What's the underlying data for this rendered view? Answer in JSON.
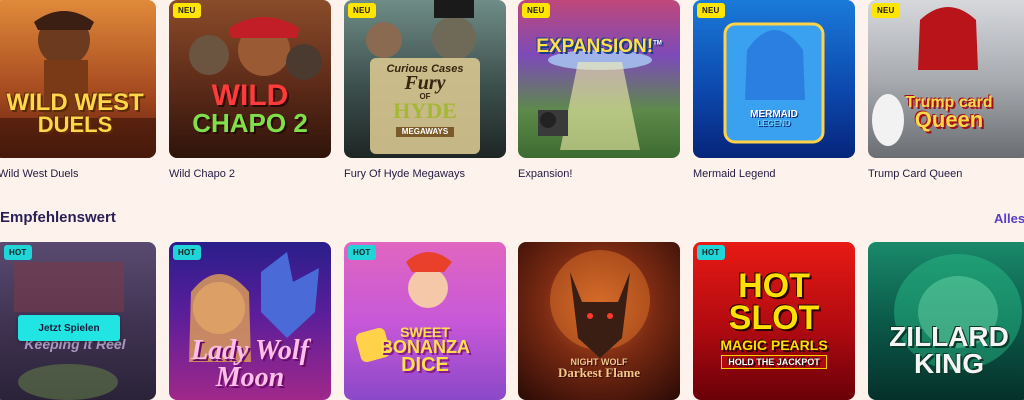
{
  "top_games": [
    {
      "badge": "",
      "title": "Wild West Duels",
      "art_line1": "WILD WEST",
      "art_line2": "DUELS"
    },
    {
      "badge": "NEU",
      "title": "Wild Chapo 2",
      "art_line1": "WILD",
      "art_line2": "CHAPO 2"
    },
    {
      "badge": "NEU",
      "title": "Fury Of Hyde Megaways",
      "art_line1": "Curious Cases",
      "art_line2": "Fury",
      "art_line3": "OF",
      "art_line4": "HYDE",
      "art_line5": "MEGAWAYS"
    },
    {
      "badge": "NEU",
      "title": "Expansion!",
      "art_line1": "EXPANSION!",
      "art_line2": "TM"
    },
    {
      "badge": "NEU",
      "title": "Mermaid Legend",
      "art_line1": "MERMAID",
      "art_line2": "LEGEND"
    },
    {
      "badge": "NEU",
      "title": "Trump Card Queen",
      "art_line1": "Trump card",
      "art_line2": "Queen"
    }
  ],
  "section": {
    "title": "Empfehlenswert",
    "all_link": "Alles"
  },
  "recommended": [
    {
      "badge": "HOT",
      "art_line1": "Keeping it Reel",
      "play_label": "Jetzt Spielen"
    },
    {
      "badge": "HOT",
      "art_line1": "Lady Wolf",
      "art_line2": "Moon"
    },
    {
      "badge": "HOT",
      "art_line1": "SWEET",
      "art_line2": "BONANZA",
      "art_line3": "DICE"
    },
    {
      "badge": "",
      "art_line1": "NIGHT WOLF",
      "art_line2": "Darkest Flame"
    },
    {
      "badge": "HOT",
      "art_line1": "HOT",
      "art_line2": "SLOT",
      "art_line3": "MAGIC PEARLS",
      "art_line4": "HOLD THE JACKPOT"
    },
    {
      "badge": "",
      "art_line1": "ZILLARD",
      "art_line2": "KING"
    }
  ]
}
